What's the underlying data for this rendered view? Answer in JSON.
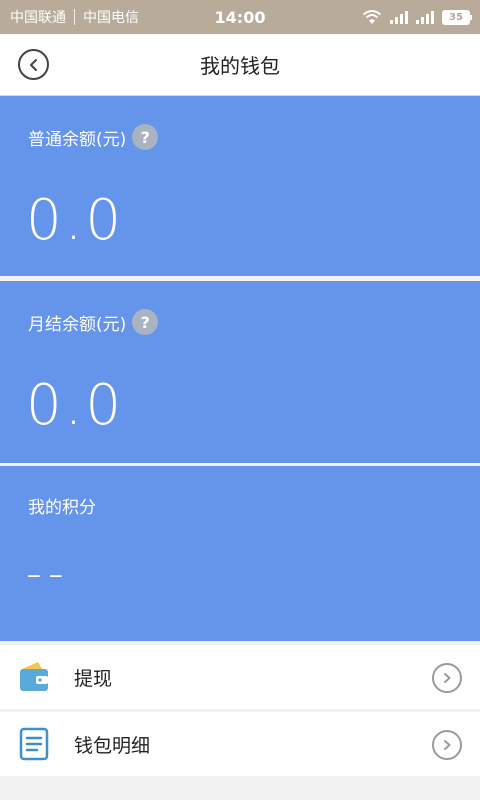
{
  "status_bar": {
    "carrier_1": "中国联通",
    "carrier_2": "中国电信",
    "time": "14:00",
    "battery": "35"
  },
  "header": {
    "title": "我的钱包",
    "back_icon": "back-circle-icon"
  },
  "balances": [
    {
      "label": "普通余额(元)",
      "value": "0.0",
      "help": "?"
    },
    {
      "label": "月结余额(元)",
      "value": "0.0",
      "help": "?"
    },
    {
      "label": "我的积分",
      "value": "--"
    }
  ],
  "menu": [
    {
      "label": "提现",
      "icon": "wallet-icon"
    },
    {
      "label": "钱包明细",
      "icon": "document-icon"
    }
  ],
  "colors": {
    "panel_blue": "#6594eb",
    "status_bar": "#b9ab9a",
    "wallet_yellow": "#f4c84a",
    "wallet_blue": "#5aa9dc",
    "doc_blue": "#3e8fd0"
  }
}
